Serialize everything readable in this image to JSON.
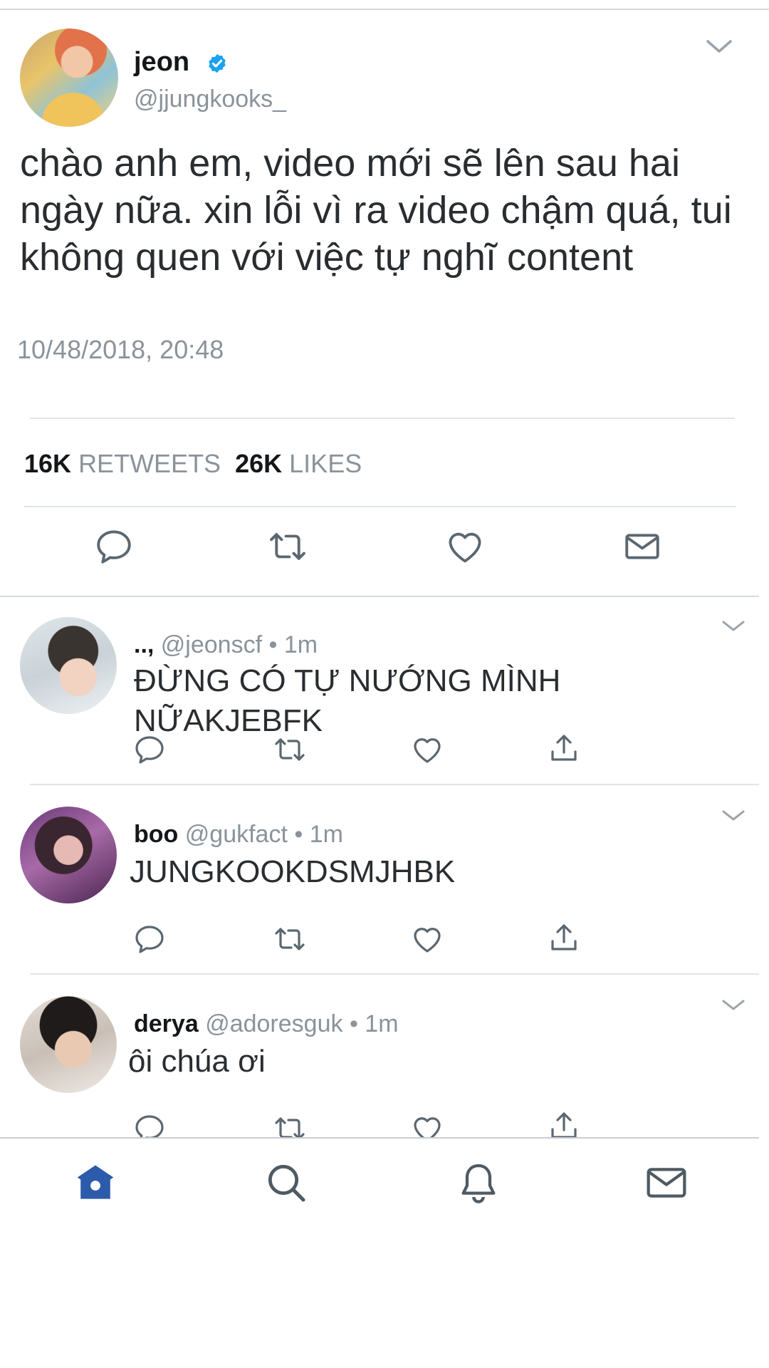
{
  "main_tweet": {
    "name": "jeon",
    "handle": "@jjungkooks_",
    "text": "chào anh em, video mới sẽ lên sau hai ngày nữa. xin lỗi vì ra video chậm quá, tui không quen với việc tự nghĩ content",
    "timestamp": "10/48/2018, 20:48",
    "retweets_count": "16K",
    "retweets_label": "RETWEETS",
    "likes_count": "26K",
    "likes_label": "LIKES"
  },
  "replies": [
    {
      "name": "..,",
      "handle": "@jeonscf",
      "time": "1m",
      "text": "ĐỪNG CÓ TỰ NƯỚNG MÌNH NỮAKJEBFK"
    },
    {
      "name": "boo",
      "handle": "@gukfact",
      "time": "1m",
      "text": "JUNGKOOKDSMJHBK"
    },
    {
      "name": "derya",
      "handle": "@adoresguk",
      "time": "1m",
      "text": "ôi chúa ơi"
    }
  ],
  "colors": {
    "accent": "#1da1f2",
    "nav_active": "#2c5bab",
    "icon_gray": "#5b6770"
  },
  "icons": {
    "reply": "reply-icon",
    "retweet": "retweet-icon",
    "like": "heart-icon",
    "share": "share-icon",
    "dm": "mail-icon",
    "nav_home": "home-icon",
    "nav_search": "search-icon",
    "nav_notifications": "bell-icon",
    "nav_messages": "mail-icon"
  }
}
